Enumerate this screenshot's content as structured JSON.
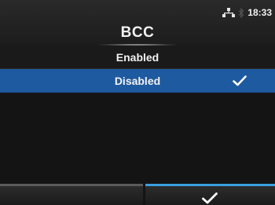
{
  "header": {
    "title": "BCC",
    "time": "18:33",
    "status_icons": [
      "network-icon",
      "bluetooth-icon"
    ]
  },
  "menu": {
    "items": [
      {
        "label": "Enabled",
        "selected": false
      },
      {
        "label": "Disabled",
        "selected": true
      }
    ]
  },
  "footer": {
    "left_button": "back",
    "right_button_icon": "checkmark-icon"
  },
  "colors": {
    "selection": "#1e5aa0",
    "confirm_accent": "#3a9fe0",
    "background": "#161616"
  }
}
